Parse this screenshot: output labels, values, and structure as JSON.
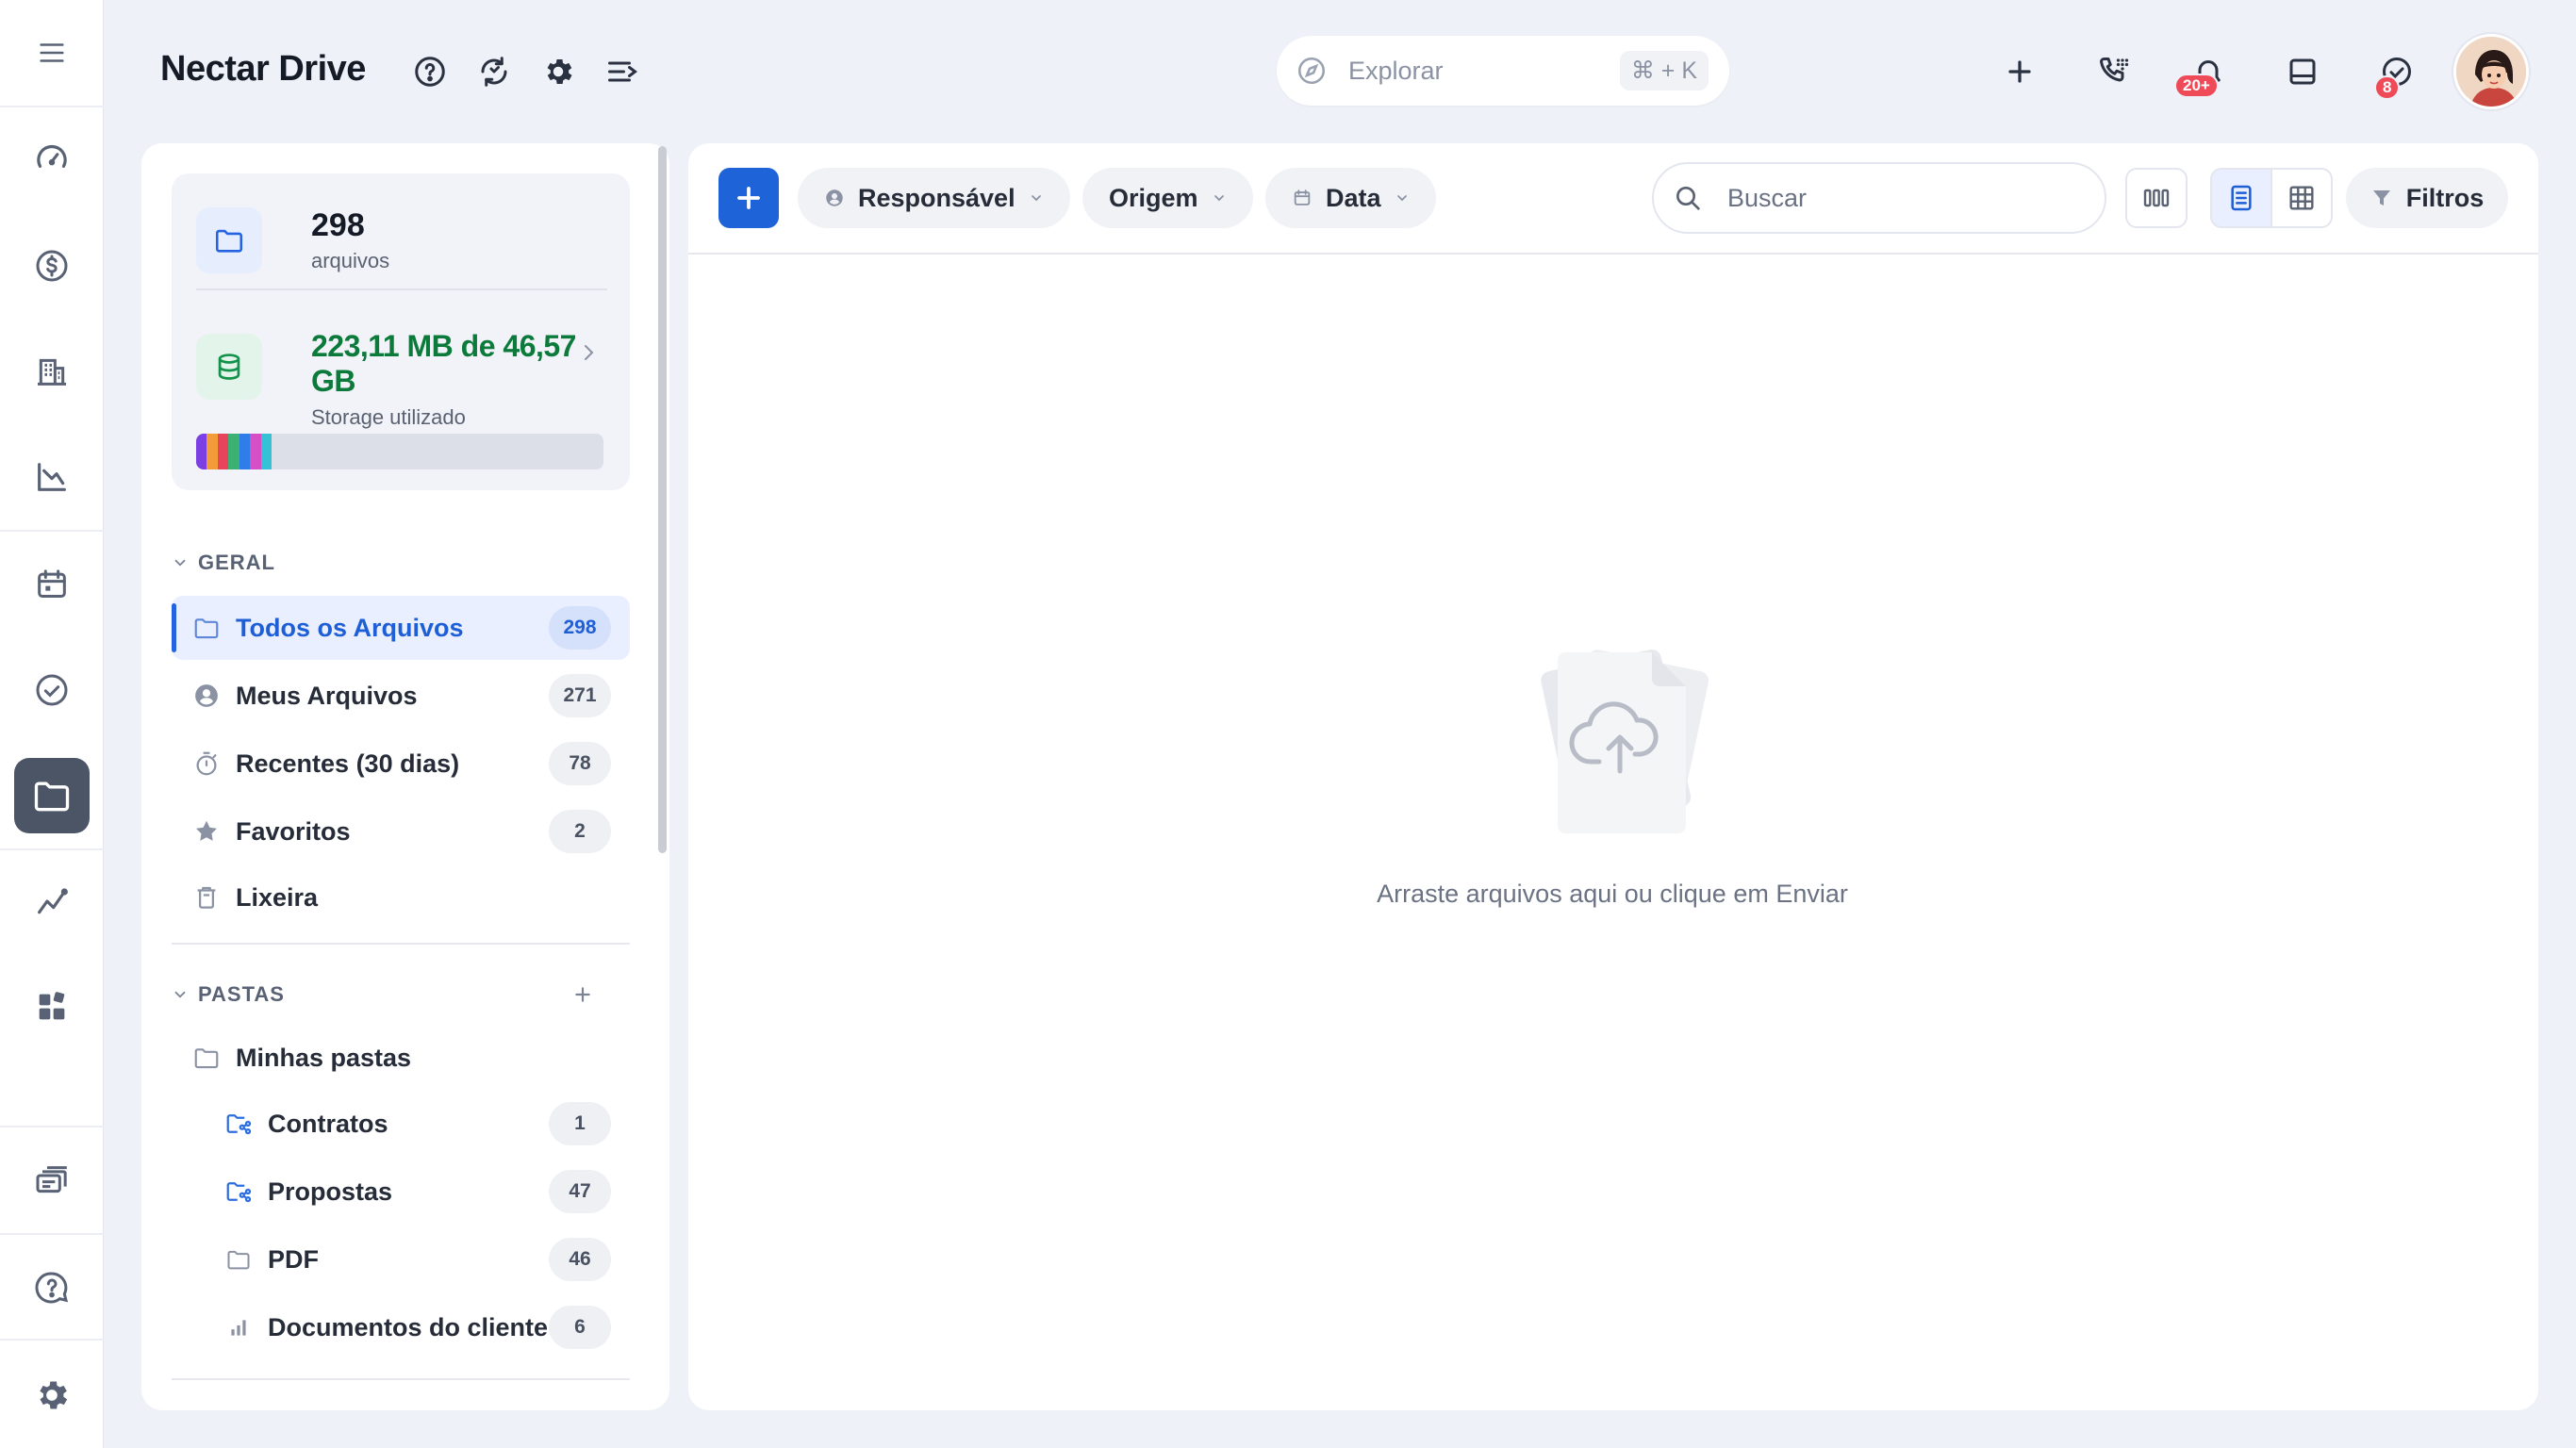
{
  "app": {
    "brand": "Nectar Drive",
    "explore_placeholder": "Explorar",
    "explore_shortcut": "⌘ + K",
    "notifications_badge": "20+",
    "tasks_badge": "8"
  },
  "storage": {
    "files_count": "298",
    "files_label": "arquivos",
    "used_value": "223,11 MB de 46,57 GB",
    "used_label": "Storage utilizado",
    "usage_colors": [
      "#7b3fe4",
      "#f29b38",
      "#e8455c",
      "#3bb273",
      "#2e7de9",
      "#d64fc7",
      "#35c2d6"
    ]
  },
  "sections": {
    "general": "GERAL",
    "folders": "PASTAS"
  },
  "general_items": [
    {
      "label": "Todos os Arquivos",
      "count": "298",
      "icon": "folder-icon"
    },
    {
      "label": "Meus Arquivos",
      "count": "271",
      "icon": "user-circle-icon"
    },
    {
      "label": "Recentes (30 dias)",
      "count": "78",
      "icon": "stopwatch-icon"
    },
    {
      "label": "Favoritos",
      "count": "2",
      "icon": "star-icon"
    },
    {
      "label": "Lixeira",
      "count": "",
      "icon": "trash-icon"
    }
  ],
  "folder_items": [
    {
      "label": "Minhas pastas",
      "icon": "folder-icon"
    },
    {
      "label": "Contratos",
      "count": "1",
      "icon": "shared-folder-icon"
    },
    {
      "label": "Propostas",
      "count": "47",
      "icon": "shared-folder-icon"
    },
    {
      "label": "PDF",
      "count": "46",
      "icon": "folder-icon"
    },
    {
      "label": "Documentos do cliente",
      "count": "6",
      "icon": "bar-chart-icon"
    }
  ],
  "toolbar": {
    "responsible": "Responsável",
    "origin": "Origem",
    "date": "Data",
    "search_placeholder": "Buscar",
    "filters": "Filtros"
  },
  "empty_state": {
    "message": "Arraste arquivos aqui ou clique em Enviar"
  }
}
